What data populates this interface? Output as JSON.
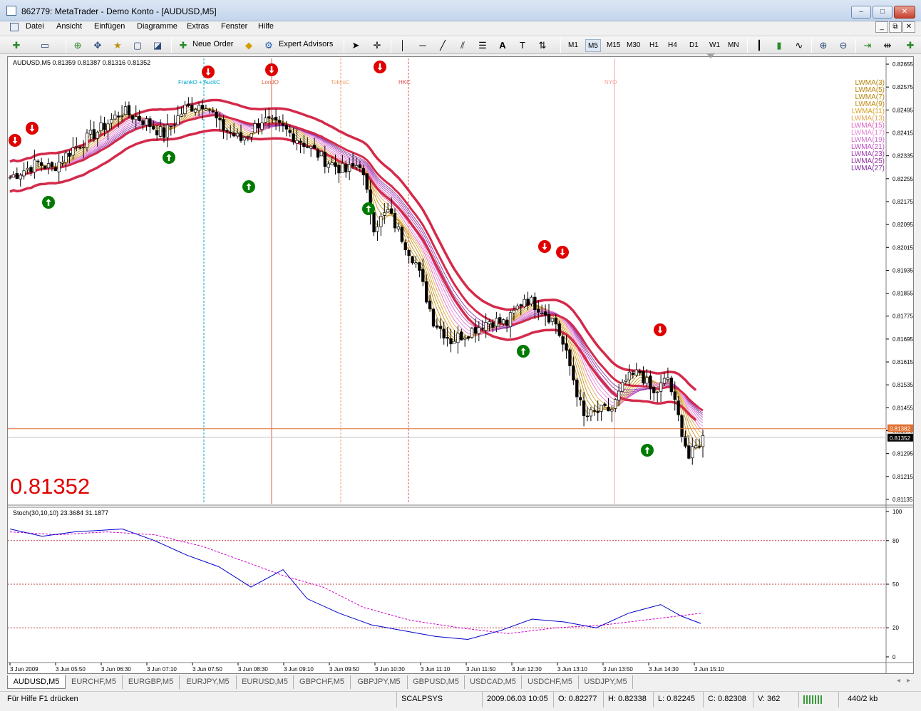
{
  "window": {
    "title": "862779: MetaTrader - Demo Konto - [AUDUSD,M5]",
    "buttons": [
      "–",
      "□",
      "✕"
    ],
    "mdi_buttons": [
      "_",
      "⧉",
      "✕"
    ]
  },
  "menu": [
    "Datei",
    "Ansicht",
    "Einfügen",
    "Diagramme",
    "Extras",
    "Fenster",
    "Hilfe"
  ],
  "toolbar": {
    "new_order": "Neue Order",
    "expert_advisors": "Expert Advisors",
    "timeframes": [
      "M1",
      "M5",
      "M15",
      "M30",
      "H1",
      "H4",
      "D1",
      "W1",
      "MN"
    ],
    "active_timeframe": "M5",
    "text_tool": "A"
  },
  "chart": {
    "header": "AUDUSD,M5  0.81359 0.81387 0.81316 0.81352",
    "big_price": "0.81352",
    "price_ticks": [
      "0.82655",
      "0.82575",
      "0.82495",
      "0.82415",
      "0.82335",
      "0.82255",
      "0.82175",
      "0.82095",
      "0.82015",
      "0.81935",
      "0.81855",
      "0.81775",
      "0.81695",
      "0.81615",
      "0.81535",
      "0.81455",
      "0.81375",
      "0.81295",
      "0.81215",
      "0.81135"
    ],
    "ask_label": "0.81382",
    "bid_label": "0.81352",
    "ask_price": 0.81382,
    "bid_price": 0.81352,
    "y_range": [
      0.8112,
      0.82675
    ],
    "sessions": [
      {
        "label": "FrankO + AuckC",
        "color": "#00aacc"
      },
      {
        "label": "LondO",
        "color": "#e06040"
      },
      {
        "label": "TokyoC",
        "color": "#f0a070"
      },
      {
        "label": "HKC",
        "color": "#e05050"
      },
      {
        "label": "NYO",
        "color": "#f4a0a0"
      }
    ],
    "lwma_legend": [
      {
        "label": "LWMA(3)",
        "color": "#b8860b"
      },
      {
        "label": "LWMA(5)",
        "color": "#b8860b"
      },
      {
        "label": "LWMA(7)",
        "color": "#b8860b"
      },
      {
        "label": "LWMA(9)",
        "color": "#c08a10"
      },
      {
        "label": "LWMA(11)",
        "color": "#d8a020"
      },
      {
        "label": "LWMA(13)",
        "color": "#e0a850"
      },
      {
        "label": "LWMA(15)",
        "color": "#e060c0"
      },
      {
        "label": "LWMA(17)",
        "color": "#e88ad8"
      },
      {
        "label": "LWMA(19)",
        "color": "#d070d0"
      },
      {
        "label": "LWMA(21)",
        "color": "#c050c0"
      },
      {
        "label": "LWMA(23)",
        "color": "#a040b0"
      },
      {
        "label": "LWMA(25)",
        "color": "#9030a0"
      },
      {
        "label": "LWMA(27)",
        "color": "#8030a0"
      }
    ],
    "time_labels": [
      "3 Jun 2009",
      "3 Jun 05:50",
      "3 Jun 06:30",
      "3 Jun 07:10",
      "3 Jun 07:50",
      "3 Jun 08:30",
      "3 Jun 09:10",
      "3 Jun 09:50",
      "3 Jun 10:30",
      "3 Jun 11:10",
      "3 Jun 11:50",
      "3 Jun 12:30",
      "3 Jun 13:10",
      "3 Jun 13:50",
      "3 Jun 14:30",
      "3 Jun 15:10"
    ]
  },
  "stoch": {
    "header": "Stoch(30,10,10) 23.3684 31.1877",
    "ticks": [
      "100",
      "80",
      "50",
      "20",
      "0"
    ],
    "levels": [
      80,
      50,
      20
    ],
    "main": 23.3684,
    "signal": 31.1877
  },
  "symbol_tabs": [
    "AUDUSD,M5",
    "EURCHF,M5",
    "EURGBP,M5",
    "EURJPY,M5",
    "EURUSD,M5",
    "GBPCHF,M5",
    "GBPJPY,M5",
    "GBPUSD,M5",
    "USDCAD,M5",
    "USDCHF,M5",
    "USDJPY,M5"
  ],
  "status": {
    "help": "Für Hilfe F1 drücken",
    "profile": "SCALPSYS",
    "datetime": "2009.06.03 10:05",
    "open": "O: 0.82277",
    "high": "H: 0.82338",
    "low": "L: 0.82245",
    "close": "C: 0.82308",
    "volume": "V: 362",
    "traffic": "440/2 kb"
  },
  "colors": {
    "bull_candle": "#ffffff",
    "bear_candle": "#000000",
    "envelope": "#d42a4a",
    "stoch_main": "#0000cc",
    "stoch_signal": "#cc00cc",
    "level_line": "#c04040",
    "ask_line": "#e07030",
    "big_price": "#e00000",
    "arrow_down": "#e00000",
    "arrow_up": "#007a00"
  }
}
